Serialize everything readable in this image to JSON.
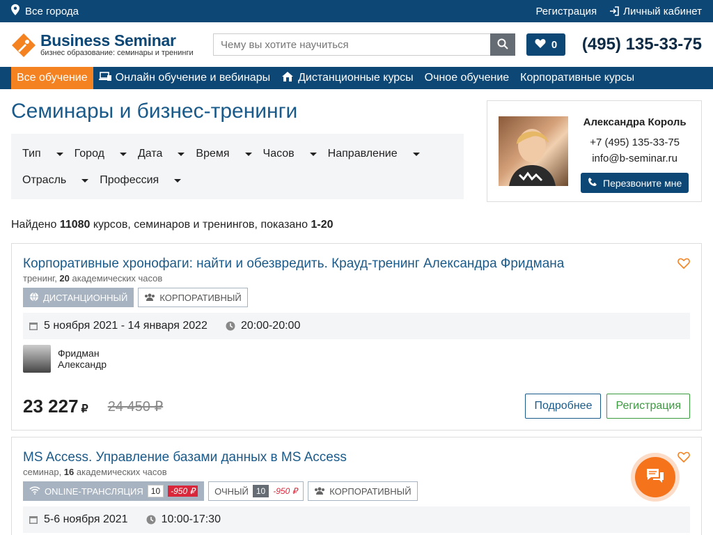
{
  "topbar": {
    "city": "Все города",
    "register": "Регистрация",
    "account": "Личный кабинет"
  },
  "header": {
    "logo_title": "Business Seminar",
    "logo_sub": "бизнес образование: семинары и тренинги",
    "search_placeholder": "Чему вы хотите научиться",
    "favorites_count": "0",
    "phone": "(495) 135-33-75"
  },
  "nav": {
    "items": [
      "Все обучение",
      "Онлайн обучение и вебинары",
      "Дистанционные курсы",
      "Очное обучение",
      "Корпоративные курсы"
    ]
  },
  "page": {
    "title": "Семинары и бизнес-тренинги",
    "filters": [
      "Тип",
      "Город",
      "Дата",
      "Время",
      "Часов",
      "Направление",
      "Отрасль",
      "Профессия"
    ],
    "found_prefix": "Найдено ",
    "found_count": "11080",
    "found_mid": " курсов, семинаров и тренингов, показано ",
    "found_range": "1-20"
  },
  "manager": {
    "name": "Александра Король",
    "phone": "+7 (495) 135-33-75",
    "email": "info@b-seminar.ru",
    "call_label": "Перезвоните мне"
  },
  "cards": [
    {
      "title": "Корпоративные хронофаги: найти и обезвредить. Крауд-тренинг Александра Фридмана",
      "type": "тренинг, ",
      "hours": "20",
      "hours_label": " академических часов",
      "tags": [
        "ДИСТАНЦИОННЫЙ",
        "КОРПОРАТИВНЫЙ"
      ],
      "dates": "5 ноября 2021 - 14 января 2022",
      "time": "20:00-20:00",
      "trainer_first": "Фридман",
      "trainer_last": "Александр",
      "price": "23 227",
      "rub": "₽",
      "old_price": "24 450 ₽",
      "more": "Подробнее",
      "register": "Регистрация"
    },
    {
      "title": "MS Access. Управление базами данных в MS Access",
      "type": "семинар, ",
      "hours": "16",
      "hours_label": " академических часов",
      "tag_online": "ONLINE-ТРАНСЛЯЦИЯ",
      "tag_online_num": "10",
      "tag_online_disc": "-950 ₽",
      "tag_offline": "ОЧНЫЙ",
      "tag_offline_num": "10",
      "tag_offline_disc": "-950 ₽",
      "tag_corp": "КОРПОРАТИВНЫЙ",
      "dates": "5-6 ноября 2021",
      "time": "10:00-17:30"
    }
  ],
  "colors": {
    "primary": "#0d4775",
    "accent": "#f58220",
    "link": "#1a5a8a",
    "green": "#3a9a3e",
    "red": "#d9263a"
  }
}
